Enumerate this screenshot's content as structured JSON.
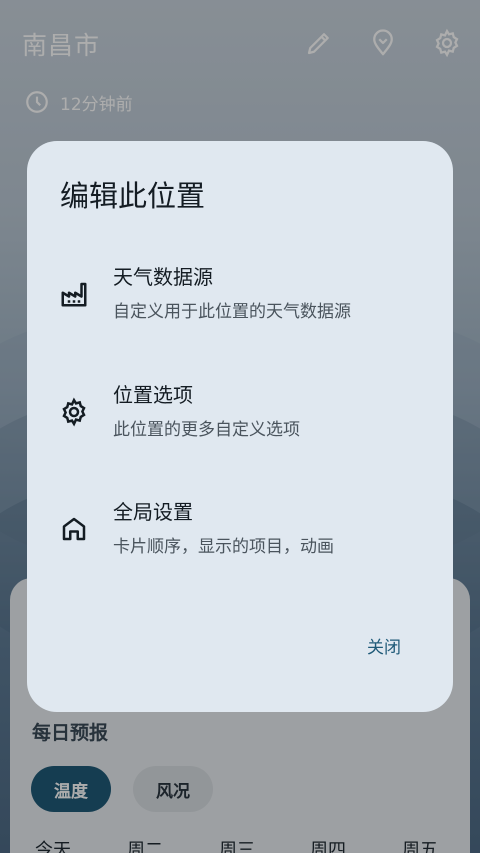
{
  "header": {
    "city": "南昌市",
    "updated": "12分钟前",
    "icons": [
      "edit-icon",
      "location-icon",
      "settings-icon"
    ]
  },
  "daily": {
    "title": "每日预报",
    "chips": {
      "temp": "温度",
      "wind": "风况"
    },
    "days": [
      "今天",
      "周二",
      "周三",
      "周四",
      "周五"
    ]
  },
  "dialog": {
    "title": "编辑此位置",
    "options": [
      {
        "title": "天气数据源",
        "subtitle": "自定义用于此位置的天气数据源",
        "icon": "factory-icon"
      },
      {
        "title": "位置选项",
        "subtitle": "此位置的更多自定义选项",
        "icon": "gear-icon"
      },
      {
        "title": "全局设置",
        "subtitle": "卡片顺序，显示的项目，动画",
        "icon": "home-icon"
      }
    ],
    "close": "关闭"
  },
  "colors": {
    "accent": "#1f5a78",
    "dialog_bg": "#e0e8f0",
    "card_bg": "#e8ecf0"
  }
}
